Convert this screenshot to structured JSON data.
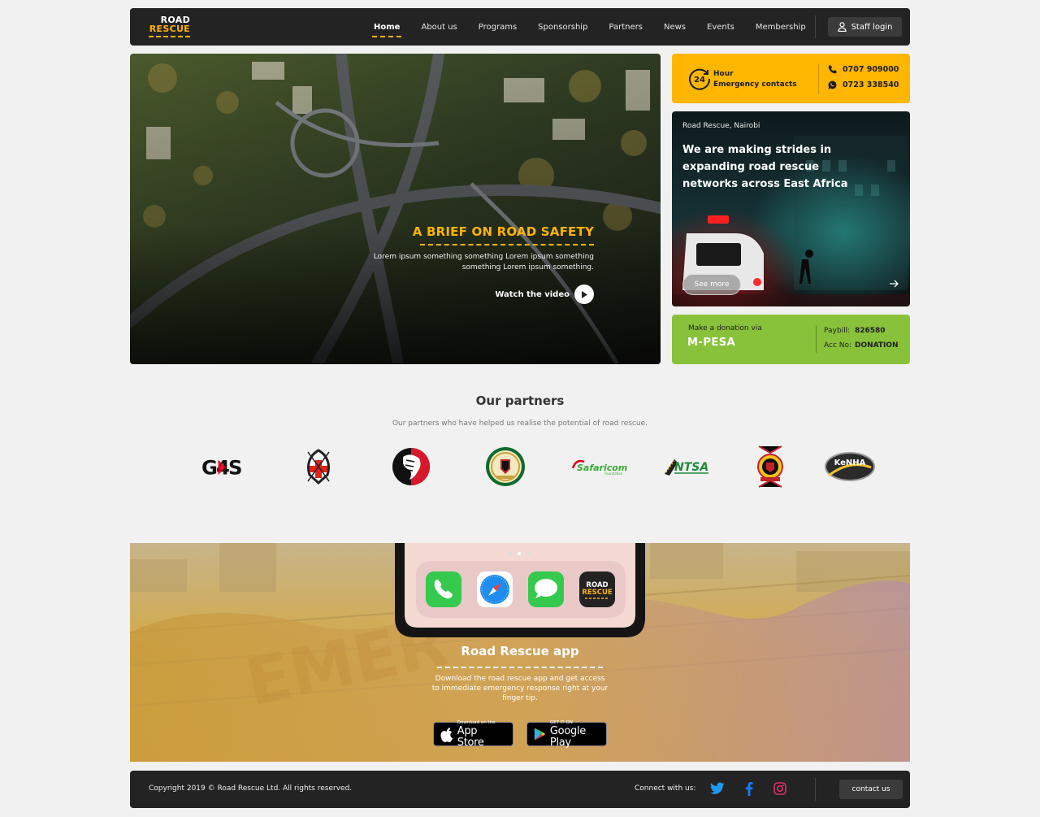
{
  "brand": {
    "line1": "ROAD",
    "line2": "RESCUE"
  },
  "nav": {
    "items": [
      {
        "label": "Home",
        "active": true
      },
      {
        "label": "About us"
      },
      {
        "label": "Programs"
      },
      {
        "label": "Sponsorship"
      },
      {
        "label": "Partners"
      },
      {
        "label": "News"
      },
      {
        "label": "Events"
      },
      {
        "label": "Membership"
      }
    ],
    "staff_login": "Staff login"
  },
  "hero": {
    "title": "A BRIEF ON ROAD SAFETY",
    "body": "Lorem ipsum something something Lorem ipsum something something Lorem ipsum something.",
    "cta": "Watch the video"
  },
  "emergency": {
    "badge": "24",
    "label_line1": "Hour",
    "label_line2": "Emergency contacts",
    "phone1": "0707 909000",
    "phone2": "0723 338540"
  },
  "news": {
    "location": "Road Rescue, Nairobi",
    "headline": "We are making strides in expanding road rescue networks across East Africa",
    "button": "See more"
  },
  "donation": {
    "label": "Make a donation via",
    "provider": "M-PESA",
    "paybill_label": "Paybill:",
    "paybill_value": "826580",
    "acc_label": "Acc No:",
    "acc_value": "DONATION"
  },
  "partners": {
    "title": "Our partners",
    "subtitle": "Our partners who have helped us realise the potential of road rescue.",
    "logos": [
      "G4S",
      "Kenya Red Cross",
      "Kenya Lion",
      "Government of Kenya",
      "Safaricom",
      "NTSA",
      "National Police",
      "KeNHA"
    ]
  },
  "app": {
    "title": "Road Rescue app",
    "body": "Download the road rescue app and get access to immediate emergency response right at your finger tip.",
    "appstore_small": "Download on the",
    "appstore_large": "App Store",
    "play_small": "GET IT ON",
    "play_large": "Google Play",
    "phone_app_line1": "ROAD",
    "phone_app_line2": "RESCUE"
  },
  "footer": {
    "copyright": "Copyright 2019 © Road Rescue Ltd.  All rights reserved.",
    "connect": "Connect with us:",
    "contact": "contact us"
  },
  "colors": {
    "accent": "#ffb400",
    "dark": "#232323",
    "green": "#88c23a"
  }
}
